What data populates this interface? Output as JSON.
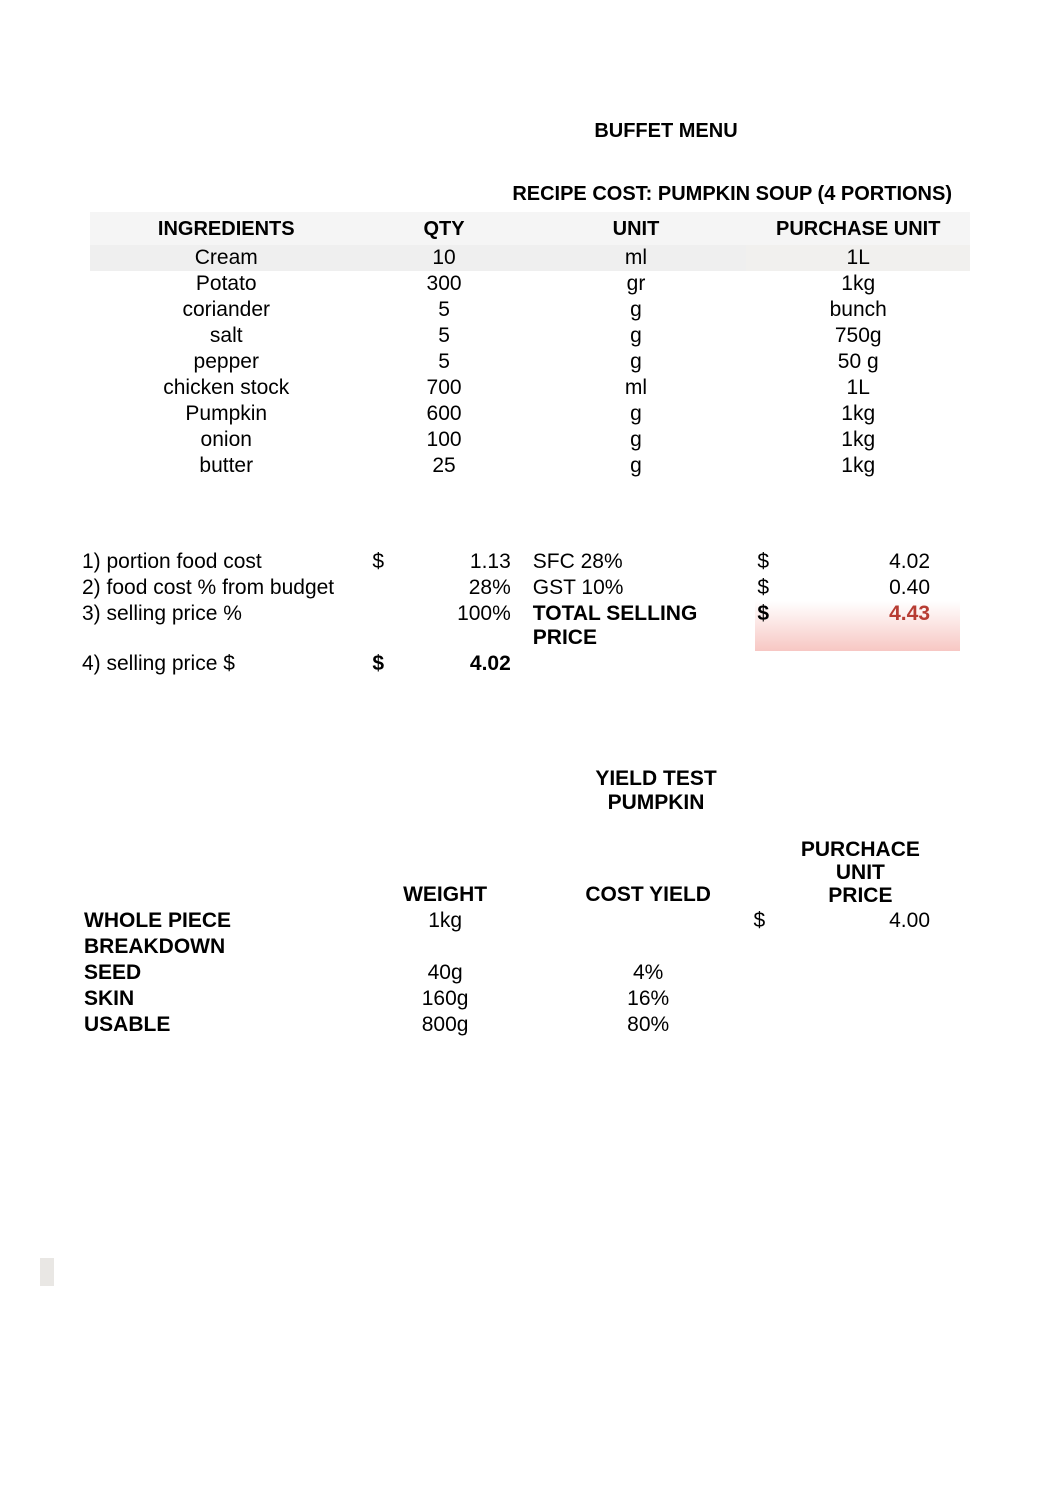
{
  "title": "BUFFET MENU",
  "recipe_header": "RECIPE COST: PUMPKIN SOUP (4 PORTIONS)",
  "ingredients": {
    "headers": {
      "ingredients": "INGREDIENTS",
      "qty": "QTY",
      "unit": "UNIT",
      "purchase_unit": "PURCHASE UNIT"
    },
    "rows": [
      {
        "name": "Cream",
        "qty": "10",
        "unit": "ml",
        "punit": "1L"
      },
      {
        "name": "Potato",
        "qty": "300",
        "unit": "gr",
        "punit": "1kg"
      },
      {
        "name": "coriander",
        "qty": "5",
        "unit": "g",
        "punit": "bunch"
      },
      {
        "name": "salt",
        "qty": "5",
        "unit": "g",
        "punit": "750g"
      },
      {
        "name": "pepper",
        "qty": "5",
        "unit": "g",
        "punit": "50 g"
      },
      {
        "name": "chicken stock",
        "qty": "700",
        "unit": "ml",
        "punit": "1L"
      },
      {
        "name": "Pumpkin",
        "qty": "600",
        "unit": "g",
        "punit": "1kg"
      },
      {
        "name": "onion",
        "qty": "100",
        "unit": "g",
        "punit": "1kg"
      },
      {
        "name": "butter",
        "qty": "25",
        "unit": "g",
        "punit": "1kg"
      }
    ]
  },
  "calc": {
    "row1": {
      "label": "1) portion food cost",
      "cur": "$",
      "val": "1.13",
      "lbl": "SFC 28%",
      "cur2": "$",
      "val2": "4.02"
    },
    "row2": {
      "label": "2) food cost % from budget",
      "cur": "",
      "val": "28%",
      "lbl": "GST 10%",
      "cur2": "$",
      "val2": "0.40"
    },
    "row3": {
      "label": "3) selling price %",
      "cur": "",
      "val": "100%",
      "lbl": "TOTAL SELLING PRICE",
      "cur2": "$",
      "val2": "4.43"
    },
    "row4": {
      "label": "4) selling price $",
      "cur": "$",
      "val": "4.02"
    }
  },
  "yield": {
    "title1": "YIELD TEST",
    "title2": "PUMPKIN",
    "headers": {
      "weight": "WEIGHT",
      "cost_yield": "COST YIELD",
      "pu_price1": "PURCHACE UNIT",
      "pu_price2": "PRICE"
    },
    "rows": [
      {
        "label": "WHOLE PIECE",
        "weight": "1kg",
        "yield": "",
        "cur": "$",
        "price": "4.00"
      },
      {
        "label": "BREAKDOWN",
        "weight": "",
        "yield": "",
        "cur": "",
        "price": ""
      },
      {
        "label": "SEED",
        "weight": "40g",
        "yield": "4%",
        "cur": "",
        "price": ""
      },
      {
        "label": "SKIN",
        "weight": "160g",
        "yield": "16%",
        "cur": "",
        "price": ""
      },
      {
        "label": "USABLE",
        "weight": "800g",
        "yield": "80%",
        "cur": "",
        "price": ""
      }
    ]
  },
  "chart_data": {
    "type": "table",
    "title": "RECIPE COST: PUMPKIN SOUP (4 PORTIONS)",
    "ingredients": [
      {
        "name": "Cream",
        "qty": 10,
        "unit": "ml",
        "purchase_unit": "1L"
      },
      {
        "name": "Potato",
        "qty": 300,
        "unit": "gr",
        "purchase_unit": "1kg"
      },
      {
        "name": "coriander",
        "qty": 5,
        "unit": "g",
        "purchase_unit": "bunch"
      },
      {
        "name": "salt",
        "qty": 5,
        "unit": "g",
        "purchase_unit": "750g"
      },
      {
        "name": "pepper",
        "qty": 5,
        "unit": "g",
        "purchase_unit": "50 g"
      },
      {
        "name": "chicken stock",
        "qty": 700,
        "unit": "ml",
        "purchase_unit": "1L"
      },
      {
        "name": "Pumpkin",
        "qty": 600,
        "unit": "g",
        "purchase_unit": "1kg"
      },
      {
        "name": "onion",
        "qty": 100,
        "unit": "g",
        "purchase_unit": "1kg"
      },
      {
        "name": "butter",
        "qty": 25,
        "unit": "g",
        "purchase_unit": "1kg"
      }
    ],
    "costing": {
      "portion_food_cost": 1.13,
      "food_cost_pct_from_budget": 28,
      "selling_price_pct": 100,
      "selling_price": 4.02,
      "sfc_pct": 28,
      "sfc_amount": 4.02,
      "gst_pct": 10,
      "gst_amount": 0.4,
      "total_selling_price": 4.43
    },
    "yield_test": {
      "item": "PUMPKIN",
      "whole_piece_weight": "1kg",
      "purchase_unit_price": 4.0,
      "breakdown": [
        {
          "part": "SEED",
          "weight": "40g",
          "yield_pct": 4
        },
        {
          "part": "SKIN",
          "weight": "160g",
          "yield_pct": 16
        },
        {
          "part": "USABLE",
          "weight": "800g",
          "yield_pct": 80
        }
      ]
    }
  }
}
